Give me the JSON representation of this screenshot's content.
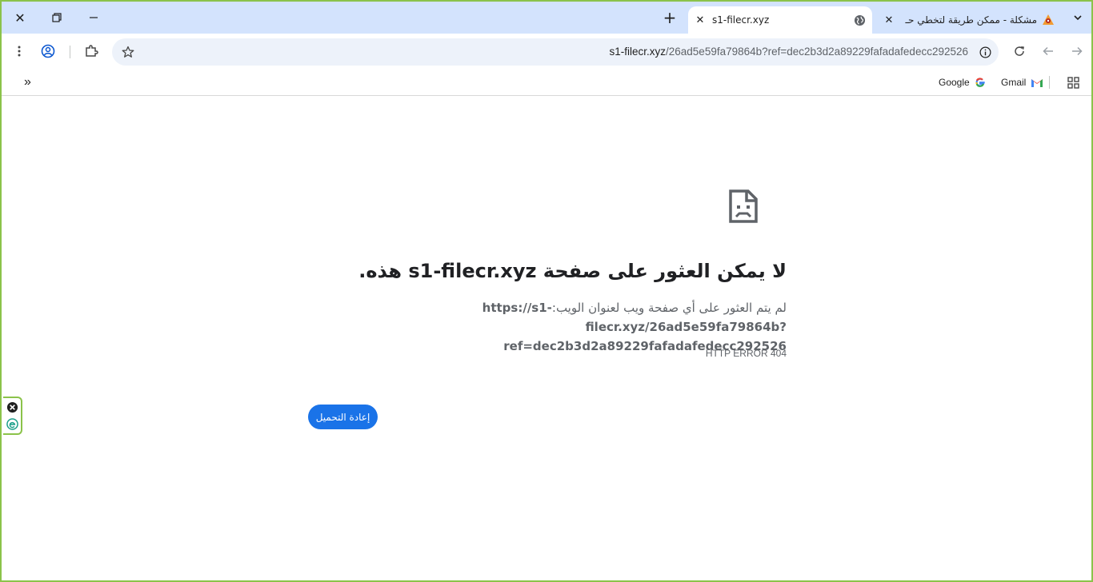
{
  "window": {
    "close_glyph": "✕",
    "restore_glyph": "❐",
    "minimize_glyph": "—"
  },
  "tabs": [
    {
      "title": "s1-filecr.xyz",
      "active": true,
      "icon": "globe-icon"
    },
    {
      "title": "مشكلة - ممكن طريقة لتخطي حـ",
      "active": false,
      "icon": "forum-favicon"
    }
  ],
  "new_tab_glyph": "+",
  "tab_search_glyph": "⌄",
  "omnibox": {
    "url_host": "s1-filecr.xyz",
    "url_rest": "/26ad5e59fa79864b?ref=dec2b3d2a89229fafadafedecc292526"
  },
  "bookmarks": {
    "overflow_glyph": "»",
    "items": [
      {
        "label": "Google",
        "icon": "google-icon"
      },
      {
        "label": "Gmail",
        "icon": "gmail-icon"
      }
    ]
  },
  "error_page": {
    "title": "لا يمكن العثور على صفحة s1-filecr.xyz هذه.",
    "description_prefix": "لم يتم العثور على أي صفحة ويب لعنوان الويب:",
    "url_line1": "https://s1-filecr.xyz/26ad5e59fa79864b?",
    "url_line2": "ref=dec2b3d2a89229fafadafedecc292526",
    "error_code": "HTTP ERROR 404",
    "reload_label": "إعادة التحميل"
  },
  "colors": {
    "accent": "#1a73e8",
    "tabstrip": "#d3e3fd",
    "frame_border": "#8bc34a"
  }
}
